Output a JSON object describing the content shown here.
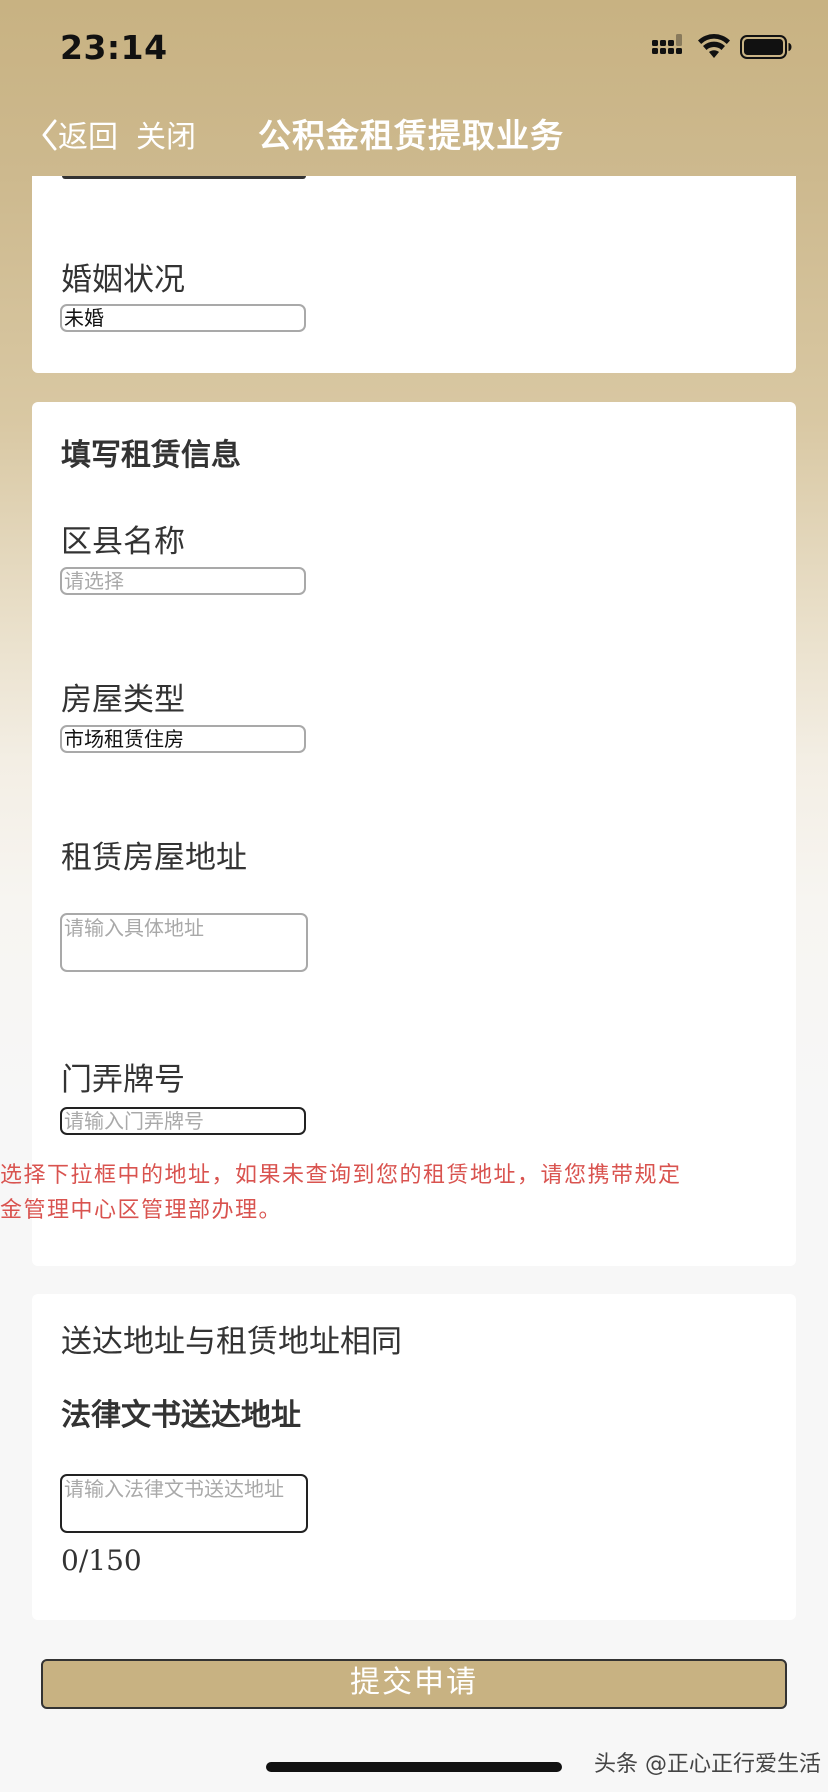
{
  "status_bar": {
    "time": "23:14"
  },
  "nav": {
    "back_label": "返回",
    "close_label": "关闭",
    "title": "公积金租赁提取业务"
  },
  "marital": {
    "label": "婚姻状况",
    "value": "未婚"
  },
  "rental_info": {
    "section_title": "填写租赁信息",
    "district": {
      "label": "区县名称",
      "placeholder": "请选择"
    },
    "house_type": {
      "label": "房屋类型",
      "value": "市场租赁住房"
    },
    "address": {
      "label": "租赁房屋地址",
      "placeholder": "请输入具体地址"
    },
    "door_number": {
      "label": "门弄牌号",
      "placeholder": "请输入门弄牌号"
    },
    "notice_line1": "选择下拉框中的地址，如果未查询到您的租赁地址，请您携带规定",
    "notice_line2": "金管理中心区管理部办理。"
  },
  "delivery": {
    "same_address_label": "送达地址与租赁地址相同",
    "section_title": "法律文书送达地址",
    "placeholder": "请输入法律文书送达地址",
    "counter": "0/150"
  },
  "submit_label": "提交申请",
  "watermark": "头条 @正心正行爱生活",
  "colors": {
    "header_gold": "#c8b282",
    "notice_red": "#d9534f",
    "placeholder_gray": "#a9a9a9"
  }
}
